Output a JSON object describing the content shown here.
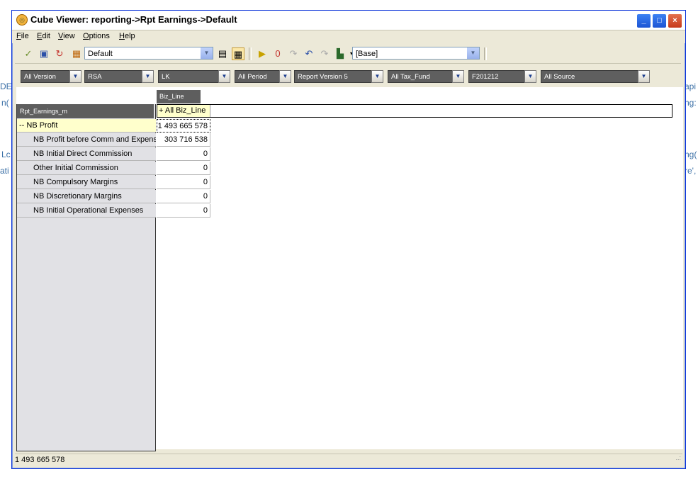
{
  "background_fragments": [
    {
      "text": "DE"
    },
    {
      "text": "n("
    },
    {
      "text": "Lc"
    },
    {
      "text": "ati"
    },
    {
      "text": "api"
    },
    {
      "text": "ng:"
    },
    {
      "text": "ng("
    },
    {
      "text": "re',"
    }
  ],
  "window": {
    "title": "Cube Viewer: reporting->Rpt Earnings->Default",
    "controls": {
      "minimize": "_",
      "maximize": "□",
      "close": "×"
    }
  },
  "menu": [
    {
      "key": "F",
      "rest": "ile"
    },
    {
      "key": "E",
      "rest": "dit"
    },
    {
      "key": "V",
      "rest": "iew"
    },
    {
      "key": "O",
      "rest": "ptions"
    },
    {
      "key": "H",
      "rest": "elp"
    }
  ],
  "toolbar": {
    "view_combo": "Default",
    "sandbox_combo": "[Base]"
  },
  "filters": [
    {
      "label": "All Version"
    },
    {
      "label": "RSA"
    },
    {
      "label": "LK"
    },
    {
      "label": "All Period"
    },
    {
      "label": "Report Version 5"
    },
    {
      "label": "All Tax_Fund"
    },
    {
      "label": "F201212"
    },
    {
      "label": "All Source"
    }
  ],
  "grid": {
    "column_dimension": "Biz_Line",
    "row_dimension": "Rpt_Earnings_m",
    "column_header": "+ All Biz_Line",
    "rows": [
      {
        "label": "-- NB Profit",
        "value": "1 493 665 578",
        "level": "top"
      },
      {
        "label": "NB Profit before Comm and Expenses",
        "value": "303 716 538",
        "level": "child"
      },
      {
        "label": "NB Initial Direct Commission",
        "value": "0",
        "level": "child"
      },
      {
        "label": "Other Initial Commission",
        "value": "0",
        "level": "child"
      },
      {
        "label": "NB Compulsory Margins",
        "value": "0",
        "level": "child"
      },
      {
        "label": "NB Discretionary Margins",
        "value": "0",
        "level": "child"
      },
      {
        "label": "NB Initial Operational Expenses",
        "value": "0",
        "level": "child"
      }
    ]
  },
  "status": {
    "text": "1 493 665 578",
    "grip": "..:"
  }
}
